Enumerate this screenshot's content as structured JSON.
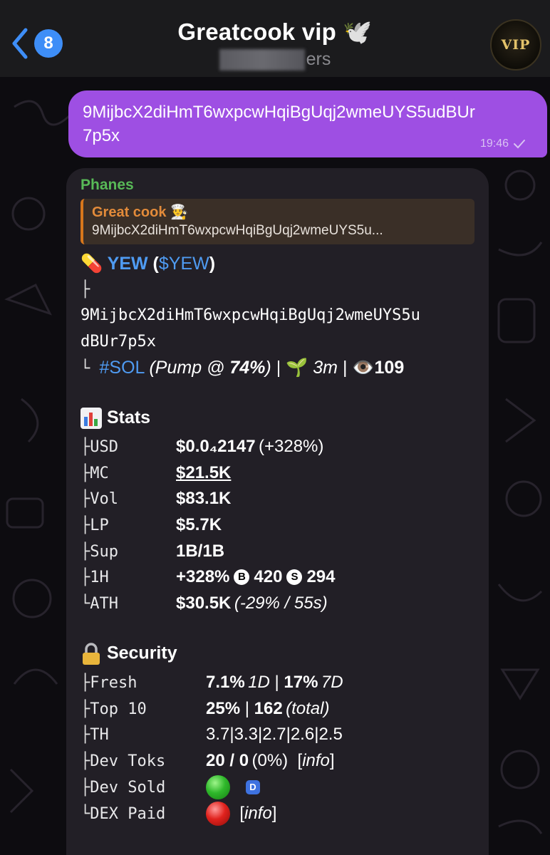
{
  "header": {
    "back_count": "8",
    "title": "Greatcook vip 🕊️",
    "subtitle_visible": "ers",
    "avatar_text": "VIP"
  },
  "outgoing": {
    "text": "9MijbcX2diHmT6wxpcwHqiBgUqj2wmeUYS5udBUr7p5x",
    "time": "19:46"
  },
  "incoming": {
    "sender": "Phanes",
    "reply": {
      "name": "Great cook 👨‍🍳",
      "text": "9MijbcX2diHmT6wxpcwHqiBgUqj2wmeUYS5u..."
    },
    "token": {
      "emoji": "💊",
      "name": "YEW",
      "symbol": "$YEW",
      "address_line1": "9MijbcX2diHmT6wxpcwHqiBgUqj2wmeUYS5u",
      "address_line2": "dBUr7p5x",
      "chain": "#SOL",
      "pump_prefix": "(Pump @ ",
      "pump_pct": "74%",
      "pump_suffix": ")",
      "age_emoji": "🌱",
      "age": "3m",
      "views_emoji": "👁️",
      "views": "109"
    },
    "stats": {
      "heading": "Stats",
      "usd_label": "USD",
      "usd_value": "$0.0₄2147",
      "usd_change": "(+328%)",
      "mc_label": "MC",
      "mc_value": "$21.5K",
      "vol_label": "Vol",
      "vol_value": "$83.1K",
      "lp_label": "LP",
      "lp_value": "$5.7K",
      "sup_label": "Sup",
      "sup_value": "1B/1B",
      "h1_label": "1H",
      "h1_value": "+328%",
      "h1_buys_icon": "B",
      "h1_buys": "420",
      "h1_sells_icon": "S",
      "h1_sells": "294",
      "ath_label": "ATH",
      "ath_value": "$30.5K",
      "ath_change": "(-29% / 55s)"
    },
    "security": {
      "heading": "Security",
      "fresh_label": "Fresh",
      "fresh_1d": "7.1%",
      "fresh_1d_unit": "1D",
      "fresh_7d": "17%",
      "fresh_7d_unit": "7D",
      "top10_label": "Top 10",
      "top10_pct": "25%",
      "top10_total": "162",
      "top10_total_unit": "(total)",
      "th_label": "TH",
      "th_values": [
        "3.7",
        "3.3",
        "2.7",
        "2.6",
        "2.5"
      ],
      "devtoks_label": "Dev Toks",
      "devtoks_value": "20 / 0",
      "devtoks_pct": "(0%)",
      "info_label": "info",
      "devsold_label": "Dev Sold",
      "devsold_badge": "D",
      "dexpaid_label": "DEX Paid"
    },
    "colors": {
      "link": "#4f9bf2",
      "outgoing_bubble": "#9e4fe3",
      "incoming_bubble": "#221f26",
      "sender": "#58b957",
      "reply_accent": "#d7771c"
    }
  }
}
